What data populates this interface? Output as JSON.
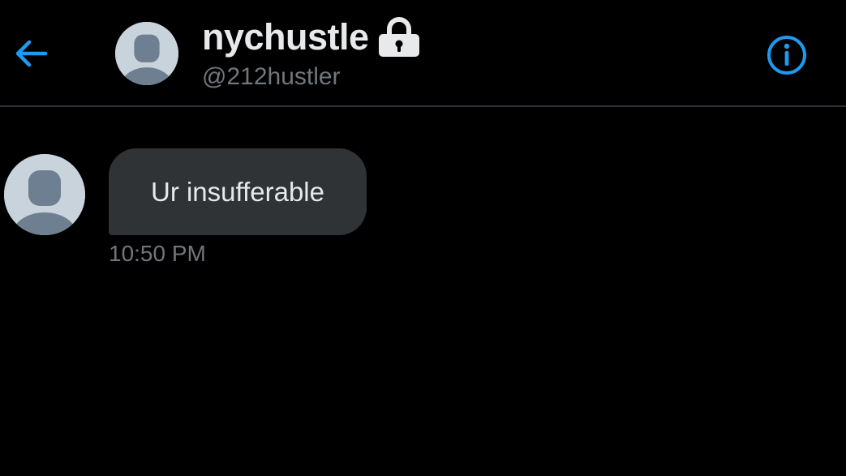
{
  "header": {
    "display_name": "nychustle",
    "handle": "@212hustler",
    "back_icon": "arrow-left-icon",
    "lock_icon": "lock-icon",
    "info_icon": "info-icon",
    "avatar_icon": "default-avatar-icon"
  },
  "conversation": {
    "messages": [
      {
        "text": "Ur insufferable",
        "time": "10:50 PM",
        "avatar_icon": "default-avatar-icon"
      }
    ]
  },
  "colors": {
    "background": "#000000",
    "accent": "#1d9bf0",
    "bubble": "#2f3336",
    "primary_text": "#e7e9ea",
    "secondary_text": "#71767b",
    "divider": "#2f3336",
    "avatar_bg": "#c9d3dc",
    "avatar_fg": "#6d7f90"
  }
}
